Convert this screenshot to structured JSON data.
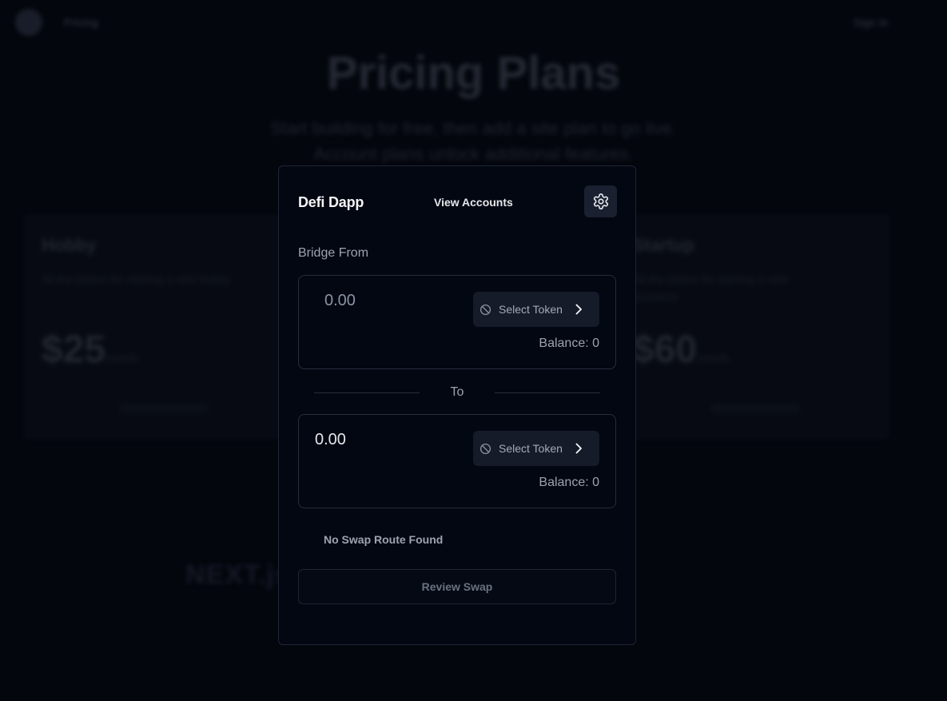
{
  "background": {
    "nav": {
      "pricing_label": "Pricing",
      "signin_label": "Sign In"
    },
    "title": "Pricing Plans",
    "subtitle_line1": "Start building for free, then add a site plan to go live.",
    "subtitle_line2": "Account plans unlock additional features.",
    "plans": [
      {
        "name": "Hobby",
        "description": "All the basics for starting a new hobby",
        "price": "$25",
        "unit": "/month"
      },
      {
        "name": "Startup",
        "description": "All the basics for starting a new business",
        "price": "$60",
        "unit": "/month"
      }
    ],
    "footer_logo": "NEXT.js"
  },
  "modal": {
    "app_title": "Defi Dapp",
    "view_accounts_label": "View Accounts",
    "settings_icon": "gear-icon",
    "bridge_from_label": "Bridge From",
    "from": {
      "amount_placeholder": "0.00",
      "select_token_label": "Select Token",
      "balance_text": "Balance: 0"
    },
    "to_label": "To",
    "to": {
      "amount_value": "0.00",
      "select_token_label": "Select Token",
      "balance_text": "Balance: 0"
    },
    "route_status": "No Swap Route Found",
    "review_swap_label": "Review Swap"
  },
  "colors": {
    "background": "#03060d",
    "modal_bg": "#030712",
    "token_button_bg": "#151b29",
    "muted_text": "#9ca3af"
  }
}
